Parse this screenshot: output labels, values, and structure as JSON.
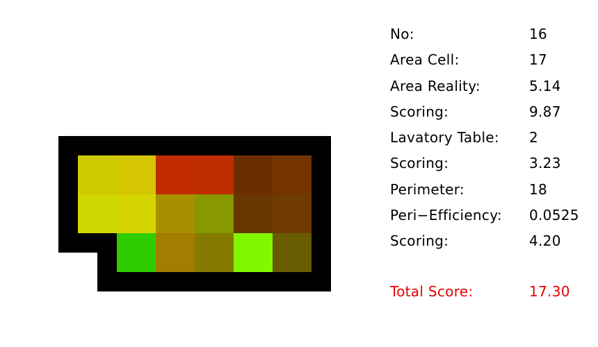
{
  "grid": {
    "colors": {
      "border": "#000000",
      "background": "#ffffff"
    },
    "cells": [
      {
        "row": 0,
        "col": 0,
        "color": "#cfcb00"
      },
      {
        "row": 0,
        "col": 1,
        "color": "#d4c600"
      },
      {
        "row": 0,
        "col": 2,
        "color": "#c12c00"
      },
      {
        "row": 0,
        "col": 3,
        "color": "#c02e00"
      },
      {
        "row": 0,
        "col": 4,
        "color": "#6c2e00"
      },
      {
        "row": 0,
        "col": 5,
        "color": "#743400"
      },
      {
        "row": 1,
        "col": 0,
        "color": "#cfd800"
      },
      {
        "row": 1,
        "col": 1,
        "color": "#d5d300"
      },
      {
        "row": 1,
        "col": 2,
        "color": "#a79000"
      },
      {
        "row": 1,
        "col": 3,
        "color": "#879800"
      },
      {
        "row": 1,
        "col": 4,
        "color": "#693600"
      },
      {
        "row": 1,
        "col": 5,
        "color": "#6f3b00"
      },
      {
        "row": 2,
        "col": 1,
        "color": "#2ecc00"
      },
      {
        "row": 2,
        "col": 2,
        "color": "#a47c00"
      },
      {
        "row": 2,
        "col": 3,
        "color": "#857a00"
      },
      {
        "row": 2,
        "col": 4,
        "color": "#82f800"
      },
      {
        "row": 2,
        "col": 5,
        "color": "#695c00"
      }
    ]
  },
  "stats": {
    "rows": [
      {
        "label": "No:",
        "value": "16"
      },
      {
        "label": "Area Cell:",
        "value": "17"
      },
      {
        "label": "Area Reality:",
        "value": "5.14"
      },
      {
        "label": "Scoring:",
        "value": "9.87"
      },
      {
        "label": "Lavatory Table:",
        "value": "2"
      },
      {
        "label": "Scoring:",
        "value": "3.23"
      },
      {
        "label": "Perimeter:",
        "value": "18"
      },
      {
        "label": "Peri−Efficiency:",
        "value": "0.0525"
      },
      {
        "label": "Scoring:",
        "value": "4.20"
      }
    ],
    "total": {
      "label": "Total Score:",
      "value": "17.30",
      "color": "#e60000"
    }
  }
}
